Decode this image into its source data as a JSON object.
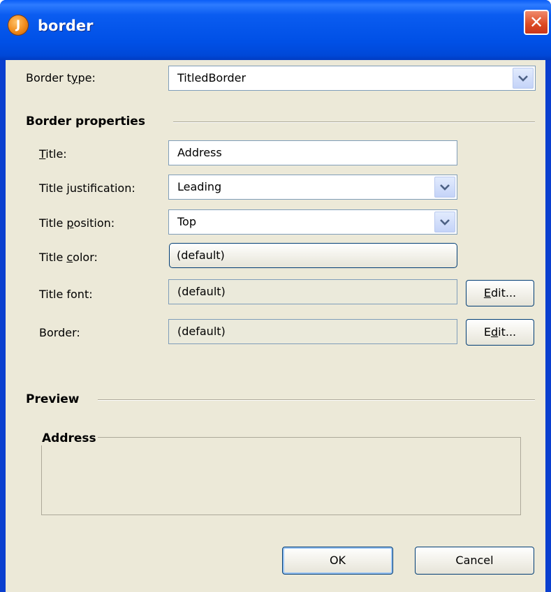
{
  "window": {
    "title": "border",
    "icon_letter": "J"
  },
  "border_type": {
    "label_prefix": "Border t",
    "label_mnemonic": "y",
    "label_suffix": "pe:",
    "value": "TitledBorder"
  },
  "border_properties": {
    "heading": "Border properties",
    "title": {
      "label_mnemonic": "T",
      "label_suffix": "itle:",
      "value": "Address"
    },
    "title_justification": {
      "label_prefix": "Title ",
      "label_mnemonic": "j",
      "label_suffix": "ustification:",
      "value": "Leading"
    },
    "title_position": {
      "label_prefix": "Title ",
      "label_mnemonic": "p",
      "label_suffix": "osition:",
      "value": "Top"
    },
    "title_color": {
      "label_prefix": "Title ",
      "label_mnemonic": "c",
      "label_suffix": "olor:",
      "value": "(default)"
    },
    "title_font": {
      "label": "Title font:",
      "value": "(default)",
      "edit_mnemonic": "E",
      "edit_suffix": "dit..."
    },
    "border": {
      "label": "Border:",
      "value": "(default)",
      "edit_prefix": "E",
      "edit_mnemonic": "d",
      "edit_suffix": "it..."
    }
  },
  "preview": {
    "heading": "Preview",
    "border_title": "Address"
  },
  "buttons": {
    "ok": "OK",
    "cancel": "Cancel"
  },
  "colors": {
    "titlebar_blue": "#0054e3",
    "dialog_background": "#ece9d8",
    "close_button_red": "#dc4a22",
    "field_border": "#7f9db9"
  },
  "icons": {
    "app": "java-app-icon",
    "close": "close-icon",
    "dropdown": "chevron-down-icon"
  }
}
